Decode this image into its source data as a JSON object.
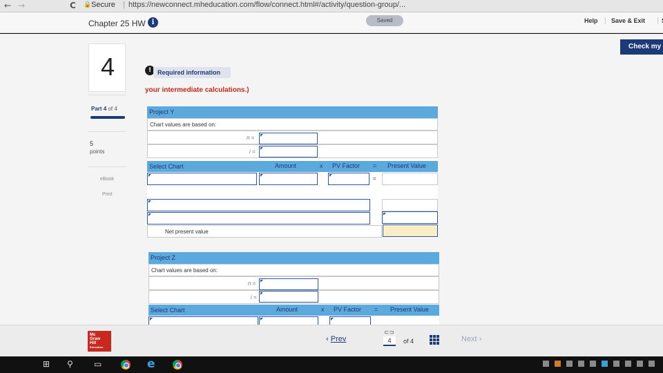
{
  "browser": {
    "back": "←",
    "forward": "→",
    "reload": "C",
    "secure_label": "Secure",
    "separator": "|",
    "url": "https://newconnect.mheducation.com/flow/connect.html#/activity/question-group/..."
  },
  "header": {
    "chapter_title": "Chapter 25 HW",
    "info_icon": "i",
    "saved_label": "Saved",
    "help_label": "Help",
    "save_exit_label": "Save & Exit",
    "trailing_label": "S"
  },
  "check_button_label": "Check my",
  "question": {
    "number": "4",
    "alert_glyph": "!",
    "required_info_label": "Required information",
    "red_note": "your intermediate calculations.)"
  },
  "sidebar": {
    "part_prefix": "Part",
    "part_current": "4",
    "part_suffix": "of 4",
    "points_value": "5",
    "points_label": "points",
    "ebook_label": "eBook",
    "print_label": "Print"
  },
  "project_y": {
    "title": "Project Y",
    "based_on": "Chart values are based on:",
    "n_label": "n =",
    "i_label": "i =",
    "select_chart": "Select Chart",
    "amount": "Amount",
    "times": "x",
    "pv_factor": "PV Factor",
    "equals": "=",
    "present_value": "Present Value",
    "row_equals": "=",
    "net_present_value": "Net present value"
  },
  "project_z": {
    "title": "Project Z",
    "based_on": "Chart values are based on:",
    "n_label": "n =",
    "i_label": "i =",
    "select_chart": "Select Chart",
    "amount": "Amount",
    "times": "x",
    "pv_factor": "PV Factor",
    "equals": "=",
    "present_value": "Present Value"
  },
  "footer": {
    "logo_lines": [
      "Mc",
      "Graw",
      "Hill",
      "Education"
    ],
    "prev_label": "Prev",
    "prev_chevron": "‹",
    "link_icon": "⊂⊃",
    "current_page": "4",
    "of_total": "of 4",
    "next_label": "Next",
    "next_chevron": "›"
  },
  "taskbar": {
    "start": "⊞",
    "search": "⚲",
    "task_view": "▭",
    "edge": "e"
  },
  "colors": {
    "brand_blue": "#1d3a78",
    "table_header": "#5ba9dd",
    "alert_red": "#c8281e",
    "npv_cell": "#faeec9"
  }
}
